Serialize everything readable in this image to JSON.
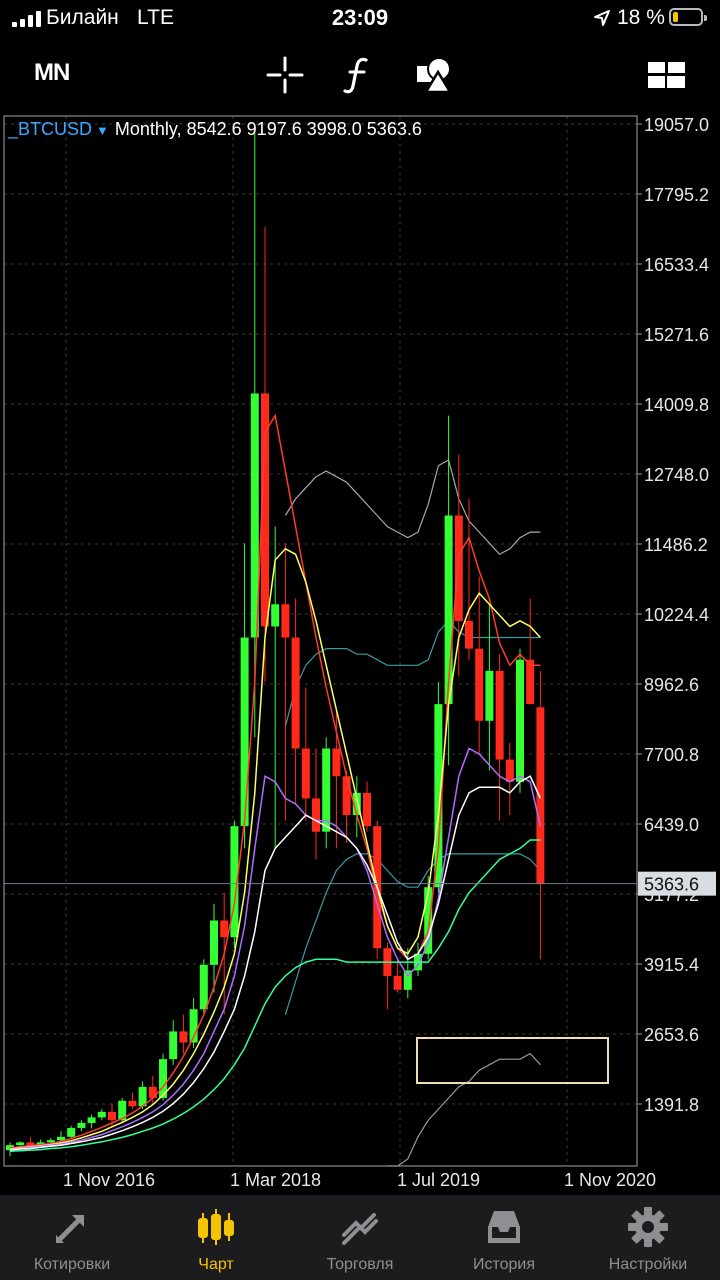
{
  "status_bar": {
    "carrier": "Билайн",
    "network": "LTE",
    "time": "23:09",
    "battery_percent": "18 %",
    "battery_level": 0.18
  },
  "toolbar": {
    "timeframe": "MN",
    "icons": [
      "crosshair-icon",
      "function-icon",
      "shapes-icon",
      "chart-layout-icon"
    ]
  },
  "chart": {
    "symbol": "_BTCUSD",
    "period": "Monthly,",
    "ohlc": [
      "8542.6",
      "9197.6",
      "3998.0",
      "5363.6"
    ],
    "current_price": "5363.6",
    "price_axis": [
      "19057.0",
      "17795.2",
      "16533.4",
      "15271.6",
      "14009.8",
      "12748.0",
      "11486.2",
      "10224.4",
      "8962.6",
      "7700.8",
      "6439.0",
      "5177.2",
      "3915.4",
      "2653.6",
      "1391.8"
    ],
    "time_axis": [
      "1 Nov 2016",
      "1 Mar 2018",
      "1 Jul 2019",
      "1 Nov 2020"
    ],
    "colors": {
      "bull": "#33ff33",
      "bear": "#ff2a1a",
      "sym": "#3da8ff",
      "accent": "#f5c400"
    }
  },
  "chart_data": {
    "type": "candlestick",
    "symbol": "_BTCUSD",
    "timeframe": "Monthly",
    "ylim": [
      0,
      19057
    ],
    "candles": [
      {
        "o": 560,
        "h": 700,
        "l": 450,
        "c": 650
      },
      {
        "o": 650,
        "h": 720,
        "l": 580,
        "c": 700
      },
      {
        "o": 700,
        "h": 800,
        "l": 650,
        "c": 620
      },
      {
        "o": 620,
        "h": 750,
        "l": 600,
        "c": 700
      },
      {
        "o": 700,
        "h": 780,
        "l": 640,
        "c": 740
      },
      {
        "o": 740,
        "h": 900,
        "l": 700,
        "c": 800
      },
      {
        "o": 800,
        "h": 1000,
        "l": 760,
        "c": 960
      },
      {
        "o": 960,
        "h": 1100,
        "l": 900,
        "c": 1050
      },
      {
        "o": 1050,
        "h": 1200,
        "l": 950,
        "c": 1150
      },
      {
        "o": 1150,
        "h": 1300,
        "l": 1100,
        "c": 1250
      },
      {
        "o": 1250,
        "h": 1400,
        "l": 1000,
        "c": 1100
      },
      {
        "o": 1100,
        "h": 1500,
        "l": 1050,
        "c": 1450
      },
      {
        "o": 1450,
        "h": 1600,
        "l": 1300,
        "c": 1350
      },
      {
        "o": 1350,
        "h": 1800,
        "l": 1300,
        "c": 1700
      },
      {
        "o": 1700,
        "h": 1900,
        "l": 1400,
        "c": 1500
      },
      {
        "o": 1500,
        "h": 2300,
        "l": 1450,
        "c": 2200
      },
      {
        "o": 2200,
        "h": 2900,
        "l": 2100,
        "c": 2700
      },
      {
        "o": 2700,
        "h": 3000,
        "l": 2300,
        "c": 2500
      },
      {
        "o": 2500,
        "h": 3300,
        "l": 2400,
        "c": 3100
      },
      {
        "o": 3100,
        "h": 4000,
        "l": 3000,
        "c": 3900
      },
      {
        "o": 3900,
        "h": 5000,
        "l": 3400,
        "c": 4700
      },
      {
        "o": 4700,
        "h": 5200,
        "l": 3000,
        "c": 4400
      },
      {
        "o": 4400,
        "h": 6500,
        "l": 4200,
        "c": 6400
      },
      {
        "o": 6400,
        "h": 11500,
        "l": 6000,
        "c": 9800
      },
      {
        "o": 9800,
        "h": 19000,
        "l": 8000,
        "c": 14200
      },
      {
        "o": 14200,
        "h": 17200,
        "l": 9000,
        "c": 10000
      },
      {
        "o": 10000,
        "h": 11800,
        "l": 6000,
        "c": 10400
      },
      {
        "o": 10400,
        "h": 11500,
        "l": 6500,
        "c": 9800
      },
      {
        "o": 9800,
        "h": 10500,
        "l": 6800,
        "c": 7800
      },
      {
        "o": 7800,
        "h": 8900,
        "l": 6500,
        "c": 6900
      },
      {
        "o": 6900,
        "h": 7800,
        "l": 5800,
        "c": 6300
      },
      {
        "o": 6300,
        "h": 8000,
        "l": 6000,
        "c": 7800
      },
      {
        "o": 7800,
        "h": 8500,
        "l": 6000,
        "c": 7300
      },
      {
        "o": 7300,
        "h": 7400,
        "l": 6100,
        "c": 6600
      },
      {
        "o": 6600,
        "h": 7300,
        "l": 6200,
        "c": 7000
      },
      {
        "o": 7000,
        "h": 7200,
        "l": 6300,
        "c": 6400
      },
      {
        "o": 6400,
        "h": 6500,
        "l": 4000,
        "c": 4200
      },
      {
        "o": 4200,
        "h": 4300,
        "l": 3100,
        "c": 3700
      },
      {
        "o": 3700,
        "h": 4000,
        "l": 3400,
        "c": 3450
      },
      {
        "o": 3450,
        "h": 4200,
        "l": 3300,
        "c": 3800
      },
      {
        "o": 3800,
        "h": 4300,
        "l": 3700,
        "c": 4100
      },
      {
        "o": 4100,
        "h": 5500,
        "l": 4000,
        "c": 5300
      },
      {
        "o": 5300,
        "h": 9000,
        "l": 5200,
        "c": 8600
      },
      {
        "o": 8600,
        "h": 13800,
        "l": 7500,
        "c": 12000
      },
      {
        "o": 12000,
        "h": 13100,
        "l": 9100,
        "c": 10100
      },
      {
        "o": 10100,
        "h": 12300,
        "l": 9400,
        "c": 9600
      },
      {
        "o": 9600,
        "h": 10900,
        "l": 7700,
        "c": 8300
      },
      {
        "o": 8300,
        "h": 10400,
        "l": 7400,
        "c": 9200
      },
      {
        "o": 9200,
        "h": 9500,
        "l": 6500,
        "c": 7600
      },
      {
        "o": 7600,
        "h": 7900,
        "l": 6600,
        "c": 7200
      },
      {
        "o": 7200,
        "h": 9600,
        "l": 7000,
        "c": 9400
      },
      {
        "o": 9400,
        "h": 10500,
        "l": 8700,
        "c": 8600
      },
      {
        "o": 8542.6,
        "h": 9197.6,
        "l": 3998.0,
        "c": 5363.6
      }
    ],
    "ma_series": [
      {
        "color": "#ff3b2a",
        "values": [
          600,
          620,
          640,
          660,
          680,
          720,
          770,
          830,
          900,
          970,
          1050,
          1130,
          1230,
          1350,
          1500,
          1700,
          1950,
          2250,
          2600,
          3000,
          3500,
          4100,
          5000,
          6500,
          9000,
          13500,
          13800,
          12800,
          11800,
          10800,
          9800,
          8900,
          8100,
          7300,
          6600,
          6000,
          5200,
          4600,
          4200,
          4000,
          4100,
          4500,
          6000,
          9000,
          11300,
          11600,
          11000,
          10500,
          9700,
          9300,
          9500,
          9300,
          9300
        ]
      },
      {
        "color": "#ffff66",
        "values": [
          580,
          600,
          620,
          640,
          660,
          690,
          730,
          780,
          840,
          900,
          980,
          1060,
          1150,
          1250,
          1380,
          1550,
          1750,
          2000,
          2300,
          2650,
          3050,
          3500,
          4100,
          5200,
          7000,
          9800,
          11200,
          11400,
          11300,
          10800,
          10100,
          9300,
          8500,
          7700,
          6900,
          6100,
          5300,
          4600,
          4200,
          4100,
          4400,
          5200,
          6600,
          8600,
          9800,
          10300,
          10600,
          10400,
          10200,
          10000,
          10100,
          10000,
          9800
        ]
      },
      {
        "color": "#b06cff",
        "values": [
          570,
          590,
          610,
          630,
          650,
          670,
          700,
          740,
          790,
          840,
          910,
          980,
          1060,
          1150,
          1250,
          1380,
          1550,
          1750,
          2000,
          2300,
          2700,
          3100,
          3700,
          4600,
          6000,
          7300,
          7200,
          6900,
          6800,
          6600,
          6500,
          6500,
          6400,
          6200,
          6000,
          5600,
          5000,
          4400,
          4000,
          3700,
          3900,
          4300,
          5100,
          6200,
          7300,
          7800,
          7700,
          7500,
          7300,
          7200,
          7300,
          7200,
          6400
        ]
      },
      {
        "color": "#ffffff",
        "values": [
          560,
          580,
          590,
          610,
          630,
          650,
          680,
          710,
          750,
          790,
          850,
          910,
          980,
          1060,
          1150,
          1260,
          1400,
          1570,
          1780,
          2030,
          2330,
          2700,
          3100,
          3700,
          4500,
          5600,
          6000,
          6200,
          6400,
          6600,
          6500,
          6400,
          6300,
          6200,
          6000,
          5700,
          5300,
          4800,
          4300,
          4000,
          4100,
          4400,
          5000,
          5800,
          6600,
          7000,
          7100,
          7100,
          7100,
          7000,
          7200,
          7300,
          6900
        ]
      },
      {
        "color": "#33ff99",
        "values": [
          540,
          550,
          560,
          570,
          590,
          600,
          620,
          650,
          680,
          710,
          750,
          790,
          840,
          900,
          960,
          1030,
          1120,
          1220,
          1340,
          1480,
          1650,
          1850,
          2100,
          2400,
          2800,
          3200,
          3500,
          3700,
          3850,
          3950,
          4000,
          4000,
          4000,
          3950,
          3950,
          3950,
          3950,
          3950,
          3950,
          3950,
          3950,
          3950,
          4200,
          4500,
          4900,
          5200,
          5400,
          5600,
          5800,
          5900,
          6000,
          6150,
          6150
        ]
      }
    ],
    "envelope_series": [
      {
        "color": "#a8a8a8",
        "values": [
          null,
          null,
          null,
          null,
          null,
          null,
          null,
          null,
          null,
          null,
          null,
          null,
          null,
          null,
          null,
          null,
          null,
          null,
          null,
          null,
          null,
          null,
          null,
          null,
          null,
          null,
          null,
          12000,
          12300,
          12500,
          12700,
          12800,
          12700,
          12600,
          12400,
          12200,
          12000,
          11800,
          11700,
          11600,
          11700,
          12200,
          12900,
          13000,
          12300,
          11900,
          11700,
          11500,
          11300,
          11400,
          11600,
          11700,
          11700
        ]
      },
      {
        "color": "#3a9ba6",
        "values": [
          null,
          null,
          null,
          null,
          null,
          null,
          null,
          null,
          null,
          null,
          null,
          null,
          null,
          null,
          null,
          null,
          null,
          null,
          null,
          null,
          null,
          null,
          null,
          null,
          null,
          null,
          null,
          8200,
          8900,
          9300,
          9500,
          9600,
          9600,
          9600,
          9500,
          9500,
          9400,
          9300,
          9300,
          9300,
          9300,
          9400,
          9900,
          10100,
          9900,
          9800,
          9800,
          9800,
          9800,
          9800,
          9800,
          9800,
          9800
        ]
      },
      {
        "color": "#3a9ba6",
        "values": [
          null,
          null,
          null,
          null,
          null,
          null,
          null,
          null,
          null,
          null,
          null,
          null,
          null,
          null,
          null,
          null,
          null,
          null,
          null,
          null,
          null,
          null,
          null,
          null,
          null,
          null,
          null,
          3000,
          3600,
          4200,
          4700,
          5200,
          5600,
          5800,
          5900,
          5900,
          5800,
          5600,
          5400,
          5300,
          5300,
          5600,
          5800,
          5900,
          5900,
          5900,
          5900,
          5900,
          5900,
          5900,
          5900,
          5800,
          5600
        ]
      },
      {
        "color": "#9a9a9a",
        "values": [
          null,
          null,
          null,
          null,
          null,
          null,
          null,
          null,
          null,
          null,
          null,
          null,
          null,
          null,
          null,
          null,
          null,
          null,
          null,
          null,
          null,
          null,
          null,
          null,
          null,
          null,
          null,
          null,
          null,
          null,
          null,
          null,
          null,
          null,
          null,
          null,
          null,
          0,
          0,
          400,
          800,
          1100,
          1300,
          1500,
          1700,
          1800,
          2000,
          2100,
          2200,
          2200,
          2200,
          2300,
          2100
        ]
      }
    ]
  },
  "tabs": [
    {
      "label": "Котировки",
      "icon": "quotes-icon",
      "active": false
    },
    {
      "label": "Чарт",
      "icon": "candles-icon",
      "active": true
    },
    {
      "label": "Торговля",
      "icon": "trade-icon",
      "active": false
    },
    {
      "label": "История",
      "icon": "history-icon",
      "active": false
    },
    {
      "label": "Настройки",
      "icon": "settings-icon",
      "active": false
    }
  ]
}
